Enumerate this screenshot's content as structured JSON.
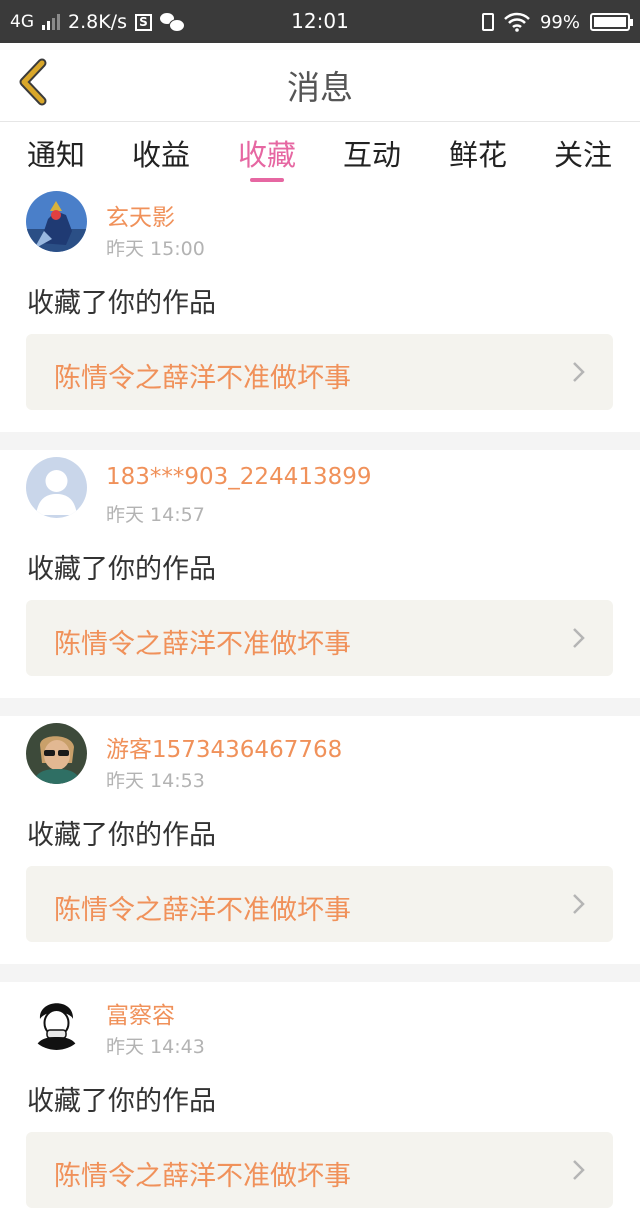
{
  "status_bar": {
    "network": "4G",
    "speed": "2.8K/s",
    "s_badge": "S",
    "time": "12:01",
    "battery": "99%",
    "icons": [
      "signal-icon",
      "s-app-icon",
      "wechat-icon",
      "vibrate-icon",
      "wifi-icon",
      "battery-icon"
    ]
  },
  "header": {
    "title": "消息",
    "back_icon": "chevron-left-icon",
    "back_color": "#d9a72a"
  },
  "tabs": [
    {
      "label": "通知",
      "active": false
    },
    {
      "label": "收益",
      "active": false
    },
    {
      "label": "收藏",
      "active": true
    },
    {
      "label": "互动",
      "active": false
    },
    {
      "label": "鲜花",
      "active": false
    },
    {
      "label": "关注",
      "active": false
    }
  ],
  "accent_color": "#e667a2",
  "name_color": "#f0915a",
  "messages": [
    {
      "user": "玄天影",
      "time": "昨天 15:00",
      "action": "收藏了你的作品",
      "work": "陈情令之薛洋不准做坏事",
      "avatar": "avatar-armored-hero"
    },
    {
      "user": "183***903_224413899",
      "time": "昨天 14:57",
      "action": "收藏了你的作品",
      "work": "陈情令之薛洋不准做坏事",
      "avatar": "avatar-default-person"
    },
    {
      "user": "游客1573436467768",
      "time": "昨天 14:53",
      "action": "收藏了你的作品",
      "work": "陈情令之薛洋不准做坏事",
      "avatar": "avatar-sunglasses-person"
    },
    {
      "user": "富察容",
      "time": "昨天 14:43",
      "action": "收藏了你的作品",
      "work": "陈情令之薛洋不准做坏事",
      "avatar": "avatar-sketch-person"
    }
  ]
}
